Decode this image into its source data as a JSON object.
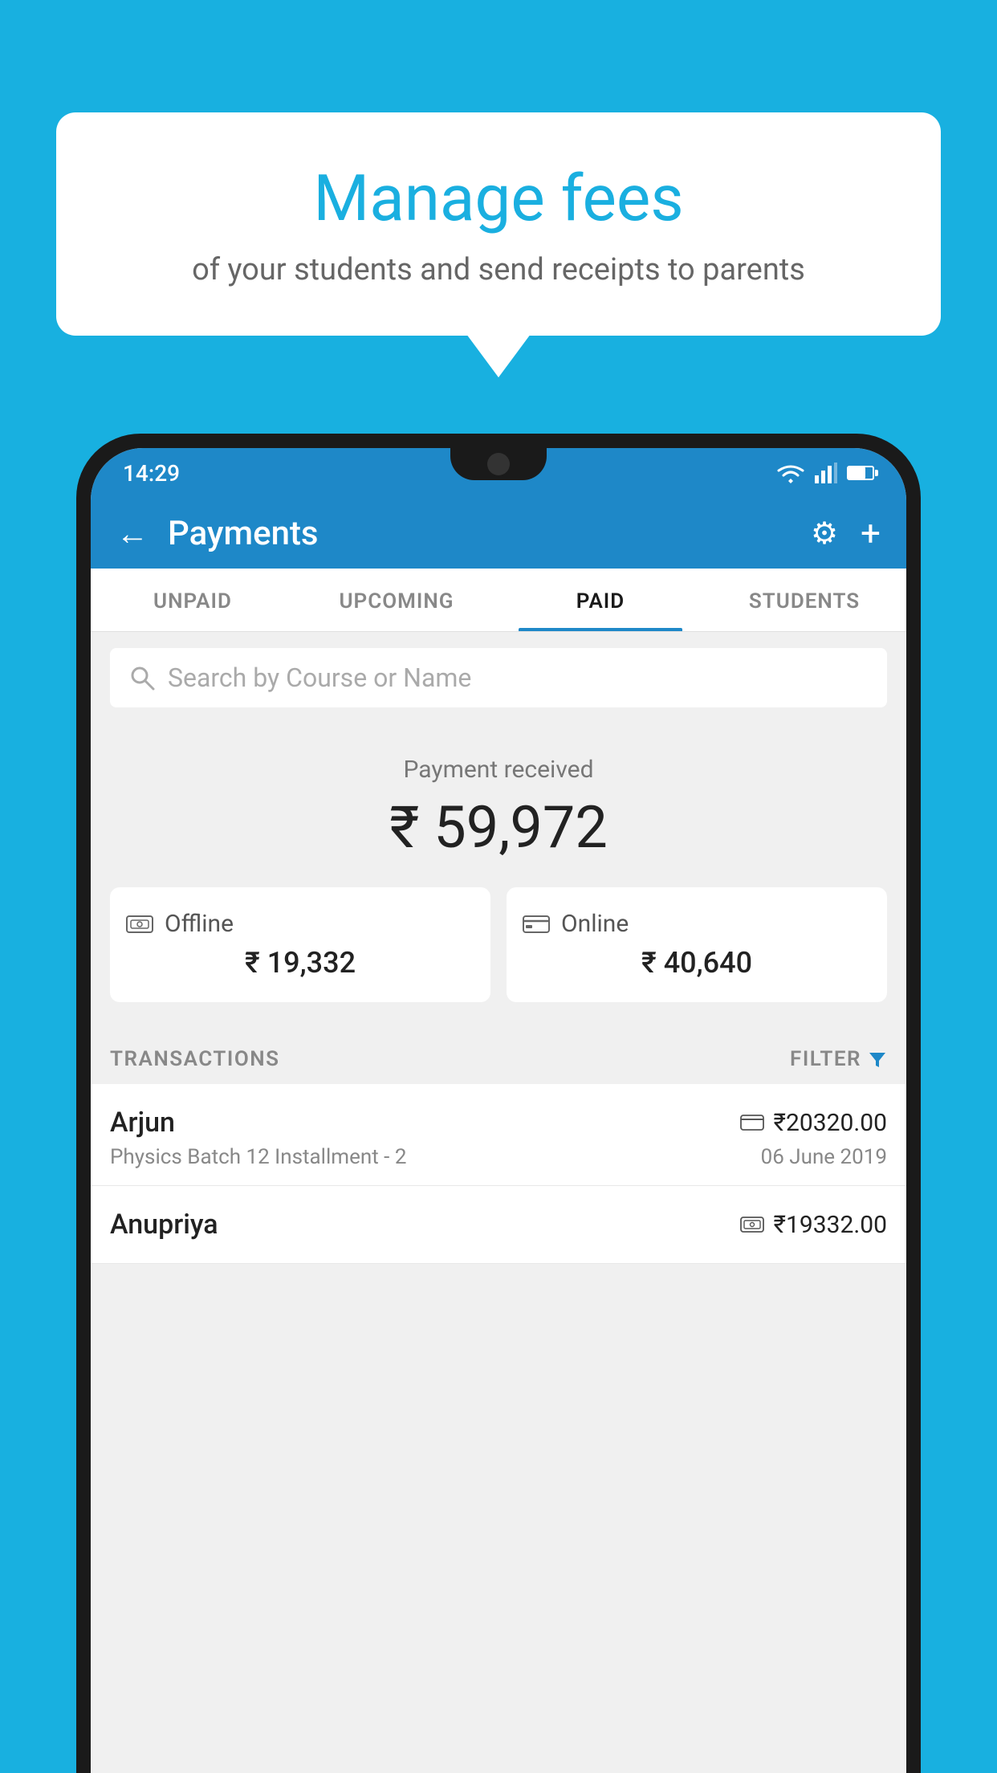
{
  "background_color": "#18b0e0",
  "speech_bubble": {
    "title": "Manage fees",
    "subtitle": "of your students and send receipts to parents"
  },
  "status_bar": {
    "time": "14:29"
  },
  "header": {
    "title": "Payments",
    "back_label": "←",
    "plus_label": "+"
  },
  "tabs": [
    {
      "id": "unpaid",
      "label": "UNPAID",
      "active": false
    },
    {
      "id": "upcoming",
      "label": "UPCOMING",
      "active": false
    },
    {
      "id": "paid",
      "label": "PAID",
      "active": true
    },
    {
      "id": "students",
      "label": "STUDENTS",
      "active": false
    }
  ],
  "search": {
    "placeholder": "Search by Course or Name"
  },
  "payment_summary": {
    "label": "Payment received",
    "total": "₹ 59,972",
    "offline": {
      "label": "Offline",
      "amount": "₹ 19,332"
    },
    "online": {
      "label": "Online",
      "amount": "₹ 40,640"
    }
  },
  "transactions_section": {
    "label": "TRANSACTIONS",
    "filter_label": "FILTER"
  },
  "transactions": [
    {
      "name": "Arjun",
      "course": "Physics Batch 12 Installment - 2",
      "amount": "₹20320.00",
      "date": "06 June 2019",
      "method": "card"
    },
    {
      "name": "Anupriya",
      "course": "",
      "amount": "₹19332.00",
      "date": "",
      "method": "cash"
    }
  ]
}
